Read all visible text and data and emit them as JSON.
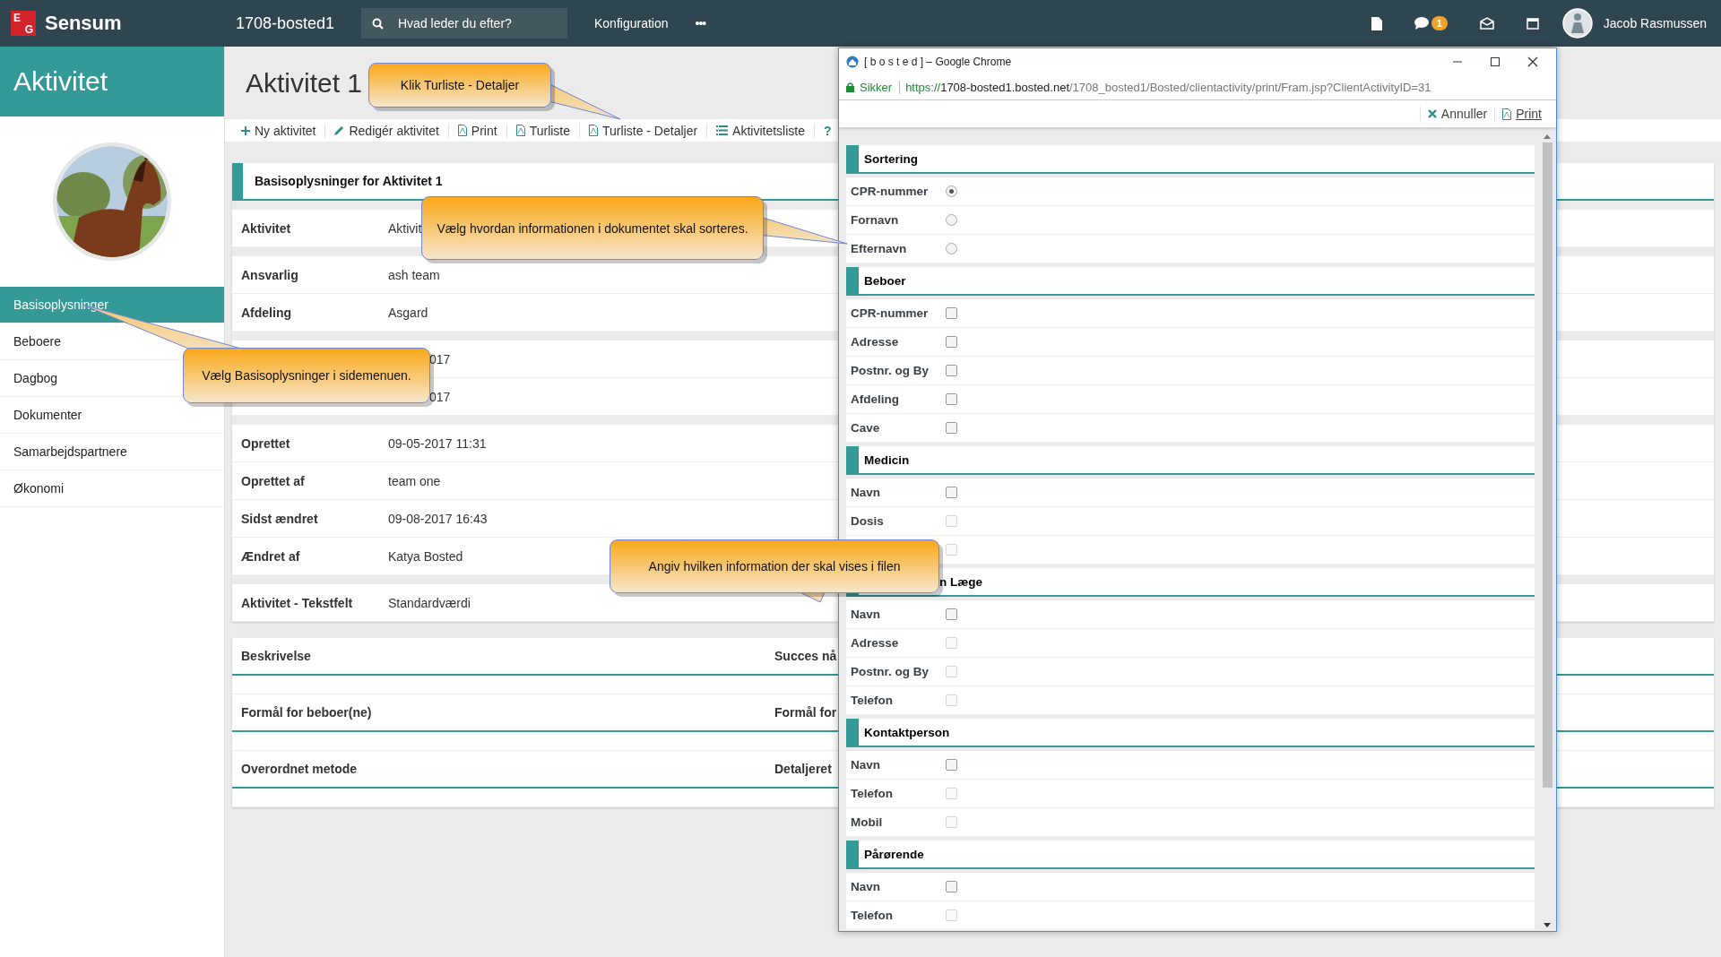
{
  "topbar": {
    "logo": [
      "E",
      "G"
    ],
    "app_name": "Sensum",
    "site": "1708-bosted1",
    "search": {
      "placeholder": "Hvad leder du efter?"
    },
    "menu": "Konfiguration",
    "more": "•••",
    "notification_count": "1",
    "user": "Jacob Rasmussen"
  },
  "sidebar": {
    "title": "Aktivitet",
    "items": [
      {
        "label": "Basisoplysninger",
        "selected": true
      },
      {
        "label": "Beboere",
        "selected": false
      },
      {
        "label": "Dagbog",
        "selected": false
      },
      {
        "label": "Dokumenter",
        "selected": false
      },
      {
        "label": "Samarbejdspartnere",
        "selected": false
      },
      {
        "label": "Økonomi",
        "selected": false
      }
    ]
  },
  "page": {
    "title": "Aktivitet 1",
    "toolbar": [
      {
        "label": "Ny aktivitet",
        "kind": "plus"
      },
      {
        "label": "Redigér aktivitet",
        "kind": "pencil"
      },
      {
        "label": "Print",
        "kind": "pdf"
      },
      {
        "label": "Turliste",
        "kind": "pdf"
      },
      {
        "label": "Turliste - Detaljer",
        "kind": "pdf"
      },
      {
        "label": "Aktivitetsliste",
        "kind": "list"
      },
      {
        "label": "?",
        "kind": "plain"
      }
    ],
    "details": {
      "title": "Basisoplysninger for Aktivitet 1",
      "groups": [
        [
          {
            "label": "Aktivitet",
            "value": "Aktivit"
          }
        ],
        [
          {
            "label": "Ansvarlig",
            "value": "ash team"
          },
          {
            "label": "Afdeling",
            "value": "Asgard"
          }
        ],
        [
          {
            "value": "017",
            "covered": true
          },
          {
            "value": "017",
            "covered": true
          }
        ],
        [
          {
            "label": "Oprettet",
            "value": "09-05-2017 11:31"
          },
          {
            "label": "Oprettet af",
            "value": "team one"
          },
          {
            "label": "Sidst ændret",
            "value": "09-08-2017 16:43"
          },
          {
            "label": "Ændret af",
            "value": "Katya Bosted"
          }
        ],
        [
          {
            "label": "Aktivitet - Tekstfelt",
            "value": "Standardværdi"
          }
        ]
      ]
    },
    "text_fields": [
      {
        "label": "Beskrivelse",
        "label_2": "Succes nå"
      },
      {
        "label": "Formål for beboer(ne)",
        "label_2": "Formål for"
      },
      {
        "label": "Overordnet metode",
        "label_2": "Detaljeret"
      }
    ]
  },
  "popup": {
    "title": "[ b o s t e d ] – Google Chrome",
    "security": "Sikker",
    "url_scheme": "https://",
    "url_host": "1708-bosted1.bosted.net",
    "url_path": "/1708_bosted1/Bosted/clientactivity/print/Fram.jsp?ClientActivityID=31",
    "actions": [
      {
        "label": "Annuller",
        "kind": "cancel"
      },
      {
        "label": "Print",
        "kind": "pdf"
      }
    ],
    "sections": [
      {
        "title": "Sortering",
        "kind": "radio",
        "items": [
          {
            "label": "CPR-nummer",
            "selected": true
          },
          {
            "label": "Fornavn",
            "selected": false
          },
          {
            "label": "Efternavn",
            "selected": false
          }
        ]
      },
      {
        "title": "Beboer",
        "kind": "checkbox",
        "items": [
          {
            "label": "CPR-nummer",
            "checked": false,
            "disabled": false
          },
          {
            "label": "Adresse",
            "checked": false,
            "disabled": false
          },
          {
            "label": "Postnr. og By",
            "checked": false,
            "disabled": false
          },
          {
            "label": "Afdeling",
            "checked": false,
            "disabled": false
          },
          {
            "label": "Cave",
            "checked": false,
            "disabled": false
          }
        ]
      },
      {
        "title": "Medicin",
        "kind": "checkbox",
        "items": [
          {
            "label": "Navn",
            "checked": false,
            "disabled": false
          },
          {
            "label": "Dosis",
            "checked": false,
            "disabled": true
          },
          {
            "checked": false,
            "disabled": true
          }
        ]
      },
      {
        "title": "n Læge",
        "covered": true,
        "kind": "checkbox",
        "items": [
          {
            "label": "Navn",
            "checked": false,
            "disabled": false
          },
          {
            "label": "Adresse",
            "checked": false,
            "disabled": true
          },
          {
            "label": "Postnr. og By",
            "checked": false,
            "disabled": true
          },
          {
            "label": "Telefon",
            "checked": false,
            "disabled": true
          }
        ]
      },
      {
        "title": "Kontaktperson",
        "kind": "checkbox",
        "items": [
          {
            "label": "Navn",
            "checked": false,
            "disabled": false
          },
          {
            "label": "Telefon",
            "checked": false,
            "disabled": true
          },
          {
            "label": "Mobil",
            "checked": false,
            "disabled": true
          }
        ]
      },
      {
        "title": "Pårørende",
        "kind": "checkbox",
        "items": [
          {
            "label": "Navn",
            "checked": false,
            "disabled": false
          },
          {
            "label": "Telefon",
            "checked": false,
            "disabled": true
          }
        ]
      }
    ]
  },
  "callouts": [
    {
      "text": "Klik Turliste - Detaljer"
    },
    {
      "text": "Vælg hvordan informationen i dokumentet skal sorteres."
    },
    {
      "text": "Vælg Basisoplysninger i sidemenuen."
    },
    {
      "text": "Angiv hvilken information der skal vises i filen"
    }
  ]
}
